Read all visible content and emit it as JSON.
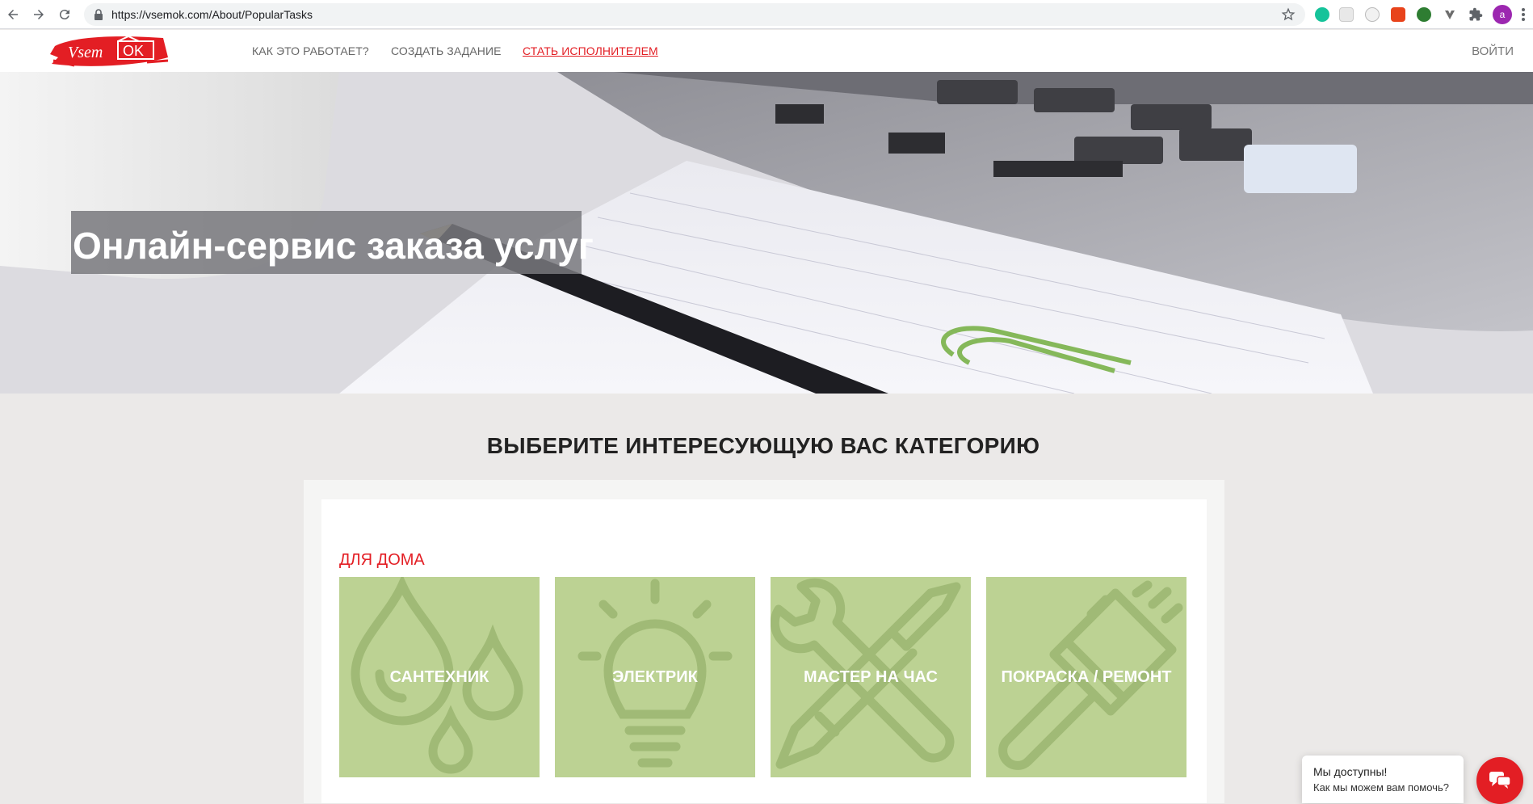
{
  "browser": {
    "url": "https://vsemok.com/About/PopularTasks",
    "profile_initial": "a"
  },
  "site": {
    "logo_text": "Vsem OK",
    "nav": [
      {
        "label": "КАК ЭТО РАБОТАЕТ?"
      },
      {
        "label": "СОЗДАТЬ ЗАДАНИЕ"
      },
      {
        "label": "СТАТЬ ИСПОЛНИТЕЛЕМ"
      }
    ],
    "login_label": "ВОЙТИ",
    "hero_title": "Онлайн-сервис заказа услуг"
  },
  "categories": {
    "title": "ВЫБЕРИТЕ ИНТЕРЕСУЮЩУЮ ВАС КАТЕГОРИЮ",
    "group_title": "ДЛЯ ДОМА",
    "tiles": [
      {
        "label": "САНТЕХНИК",
        "icon": "water-drops-icon"
      },
      {
        "label": "ЭЛЕКТРИК",
        "icon": "lightbulb-icon"
      },
      {
        "label": "МАСТЕР НА ЧАС",
        "icon": "wrench-screwdriver-icon"
      },
      {
        "label": "ПОКРАСКА / РЕМОНТ",
        "icon": "paintbrush-icon"
      }
    ],
    "tile_color": "#bcd293"
  },
  "chat": {
    "line1": "Мы доступны!",
    "line2": "Как мы можем вам помочь?"
  },
  "colors": {
    "accent": "#e31e24"
  }
}
